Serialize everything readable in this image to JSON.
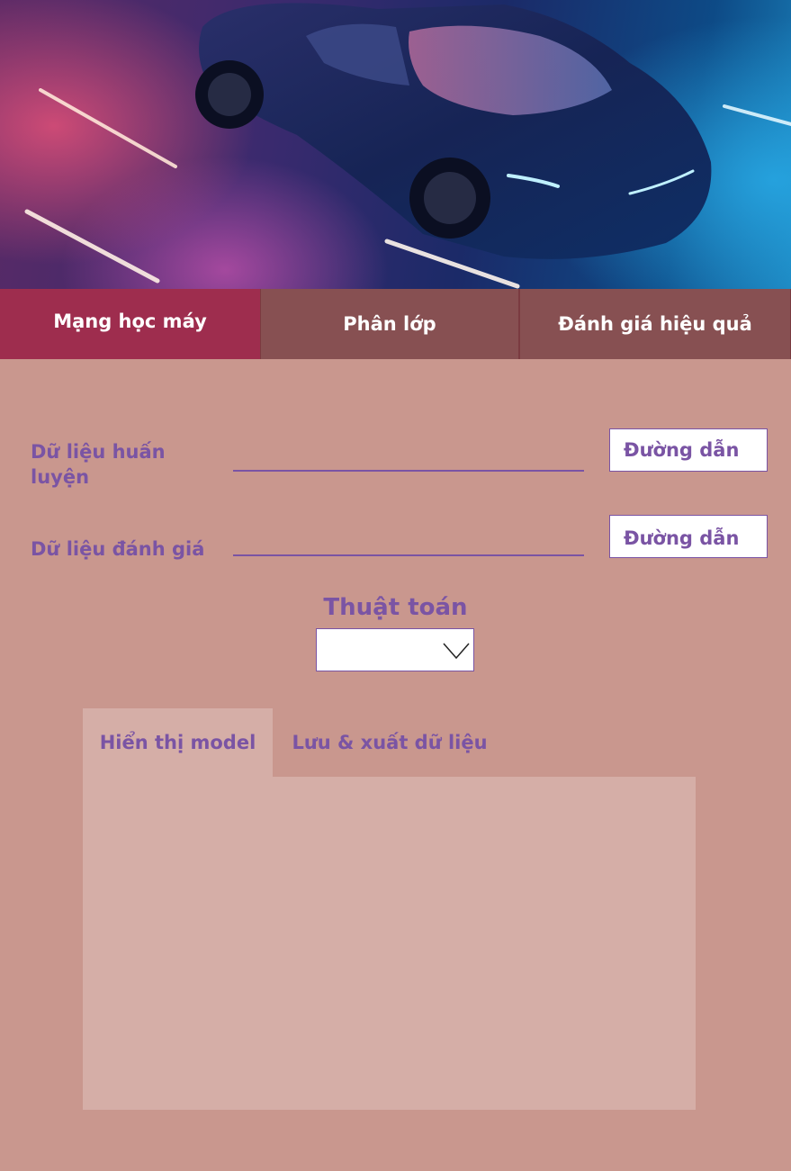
{
  "hero": {
    "image": "sports-car-banner"
  },
  "tabs": [
    {
      "label": "Mạng học máy",
      "active": true
    },
    {
      "label": "Phân lớp",
      "active": false
    },
    {
      "label": "Đánh giá hiệu quả",
      "active": false
    }
  ],
  "form": {
    "train_label": "Dữ liệu huấn luyện",
    "train_value": "",
    "train_button": "Đường dẫn",
    "eval_label": "Dữ liệu đánh giá",
    "eval_value": "",
    "eval_button": "Đường dẫn",
    "algorithm_label": "Thuật toán",
    "algorithm_selected": ""
  },
  "bottom_tabs": [
    {
      "label": "Hiển thị model",
      "active": true
    },
    {
      "label": "Lưu & xuất dữ liệu",
      "active": false
    }
  ],
  "icons": {
    "dropdown": "chevron-down-icon"
  },
  "colors": {
    "background": "#c9978e",
    "active_tab": "#9e2d4e",
    "inactive_tab": "#875052",
    "accent_text": "#7a54a4",
    "panel": "#d5aea7"
  }
}
